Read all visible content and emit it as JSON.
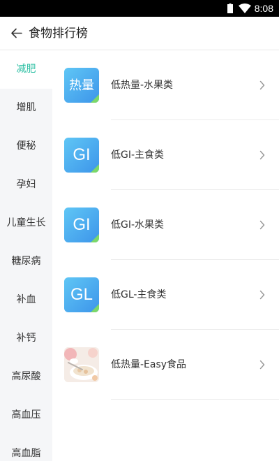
{
  "status_bar": {
    "time": "8:08"
  },
  "header": {
    "title": "食物排行榜"
  },
  "sidebar": {
    "items": [
      {
        "label": "减肥",
        "active": true
      },
      {
        "label": "增肌",
        "active": false
      },
      {
        "label": "便秘",
        "active": false
      },
      {
        "label": "孕妇",
        "active": false
      },
      {
        "label": "儿童生长",
        "active": false
      },
      {
        "label": "糖尿病",
        "active": false
      },
      {
        "label": "补血",
        "active": false
      },
      {
        "label": "补钙",
        "active": false
      },
      {
        "label": "高尿酸",
        "active": false
      },
      {
        "label": "高血压",
        "active": false
      },
      {
        "label": "高血脂",
        "active": false
      }
    ]
  },
  "list": {
    "items": [
      {
        "thumb_text": "热量",
        "label": "低热量-水果类"
      },
      {
        "thumb_text": "GI",
        "label": "低GI-主食类"
      },
      {
        "thumb_text": "GI",
        "label": "低GI-水果类"
      },
      {
        "thumb_text": "GL",
        "label": "低GL-主食类"
      },
      {
        "thumb_text": "",
        "label": "低热量-Easy食品"
      }
    ]
  },
  "colors": {
    "accent": "#2bbfa3",
    "thumb_gradient_start": "#5fc6f5",
    "thumb_gradient_end": "#3d95ea",
    "thumb_corner": "#7cd86a",
    "sidebar_bg": "#f5f6f8"
  },
  "icons": {
    "back": "arrow-left-icon",
    "chevron": "chevron-right-icon",
    "wifi": "wifi-icon",
    "battery": "battery-icon"
  }
}
